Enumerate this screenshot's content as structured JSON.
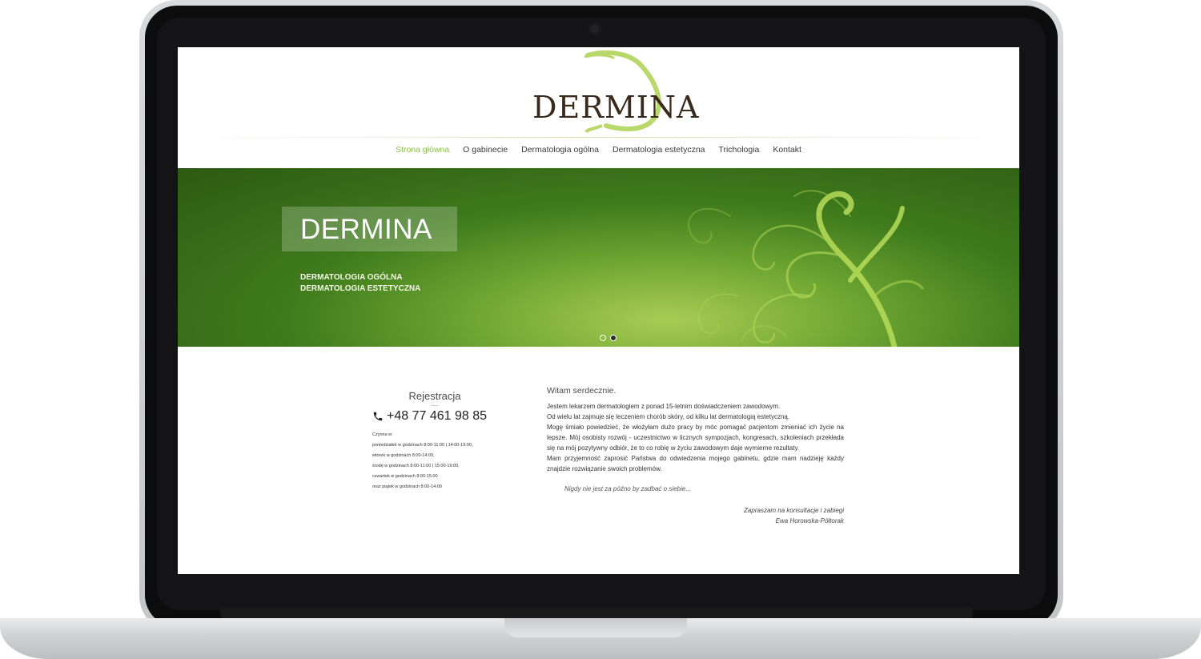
{
  "brand": {
    "logo_text": "DERMINA"
  },
  "nav": {
    "items": [
      {
        "label": "Strona główna",
        "active": true
      },
      {
        "label": "O gabinecie",
        "active": false
      },
      {
        "label": "Dermatologia ogólna",
        "active": false
      },
      {
        "label": "Dermatologia estetyczna",
        "active": false
      },
      {
        "label": "Trichologia",
        "active": false
      },
      {
        "label": "Kontakt",
        "active": false
      }
    ]
  },
  "hero": {
    "title": "DERMINA",
    "line1": "DERMATOLOGIA OGÓLNA",
    "line2": "DERMATOLOGIA ESTETYCZNA",
    "slides": 2,
    "active_slide": 2
  },
  "registration": {
    "title": "Rejestracja",
    "phone": "+48 77 461 98 85",
    "hours": [
      "Czynna w:",
      "poniedziałek w godzinach 8:00-11:00 | 14:00-19:00,",
      "wtorek w godzinach 8:00-14:00,",
      "środę w godzinach 8:00-11:00 | 15:00-19:00,",
      "czwartek w godzinach 8:00-15:00",
      "oraz piątek w godzinach 8:00-14:00"
    ]
  },
  "content": {
    "greeting": "Witam serdecznie.",
    "paragraphs": [
      "Jestem lekarzem dermatologiem z ponad 15-letnim doświadczeniem zawodowym.",
      "Od wielu lat zajmuje się leczeniem chorób skóry, od kilku lat dermatologią estetyczną.",
      "Mogę śmiało powiedzieć, że włożyłam dużo pracy by móc pomagać pacjentom zmieniać ich życie na lepsze. Mój osobisty rozwój - uczestnictwo w licznych sympozjach, kongresach, szkoleniach przekłada się na mój pozytywny odbiór, że to co robię w życiu zawodowym daje wymierne rezultaty.",
      "Mam przyjemność zaprosić Państwa do odwiedzenia mojego gabinetu, gdzie mam nadzieję każdy znajdzie rozwiązanie swoich problemów."
    ],
    "motto": "Nigdy nie jest za późno by zadbać o siebie...",
    "signature_line1": "Zapraszam na konsultacje i zabiegi",
    "signature_line2": "Ewa Horowska-Półtorak"
  },
  "colors": {
    "accent": "#8cc14c",
    "hero_dark": "#2c5a12",
    "logo_brown": "#3a2a1c"
  },
  "icons": {
    "phone": "phone-icon"
  }
}
